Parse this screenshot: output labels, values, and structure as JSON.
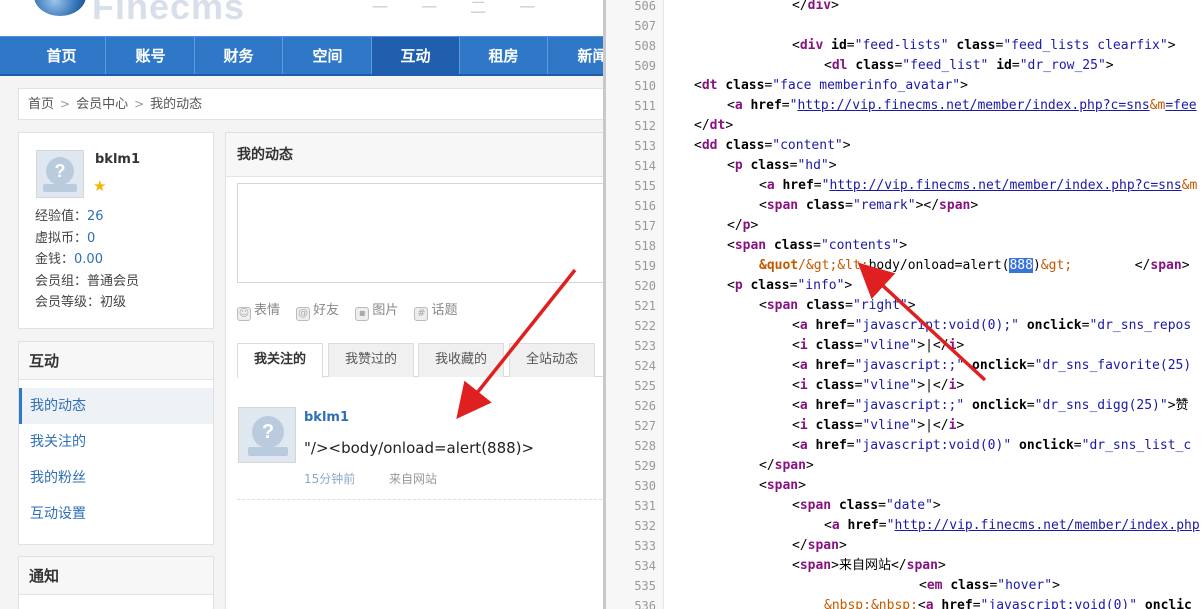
{
  "site": {
    "logo_text": "Finecms",
    "topbar_deco": "一 一 二 一",
    "nav": [
      "首页",
      "账号",
      "财务",
      "空间",
      "互动",
      "租房",
      "新闻"
    ],
    "nav_active": 4,
    "breadcrumb": [
      "首页",
      "会员中心",
      "我的动态"
    ],
    "profile": {
      "username": "bklm1",
      "stats": [
        {
          "label": "经验值：",
          "value": "26"
        },
        {
          "label": "虚拟币：",
          "value": "0"
        },
        {
          "label": "金钱：",
          "value": "0.00"
        },
        {
          "label": "会员组：",
          "value": "普通会员"
        },
        {
          "label": "会员等级：",
          "value": "初级"
        }
      ]
    },
    "sidebar_interact": {
      "title": "互动",
      "items": [
        "我的动态",
        "我关注的",
        "我的粉丝",
        "互动设置"
      ],
      "active": 0
    },
    "sidebar_notice": {
      "title": "通知"
    },
    "content": {
      "title": "我的动态",
      "tools": [
        "表情",
        "好友",
        "图片",
        "话题"
      ],
      "tabs": [
        "我关注的",
        "我赞过的",
        "我收藏的",
        "全站动态"
      ],
      "tab_active": 0,
      "feed": {
        "user": "bklm1",
        "text": "\"/><body/onload=alert(888)>",
        "time": "15分钟前",
        "source": "来自网站"
      }
    }
  },
  "source_view": {
    "line_numbers": [
      "506",
      "507",
      "508",
      "509",
      "510",
      "511",
      "512",
      "513",
      "514",
      "515",
      "516",
      "517",
      "518",
      "519",
      "520",
      "521",
      "522",
      "523",
      "524",
      "525",
      "526",
      "527",
      "528",
      "529",
      "530",
      "531",
      "532",
      "533",
      "534",
      "535",
      "536"
    ],
    "highlighted_text": "888"
  },
  "colors": {
    "nav_blue": "#2f78c8",
    "link_blue": "#2e6fb7",
    "arrow_red": "#e02020"
  }
}
